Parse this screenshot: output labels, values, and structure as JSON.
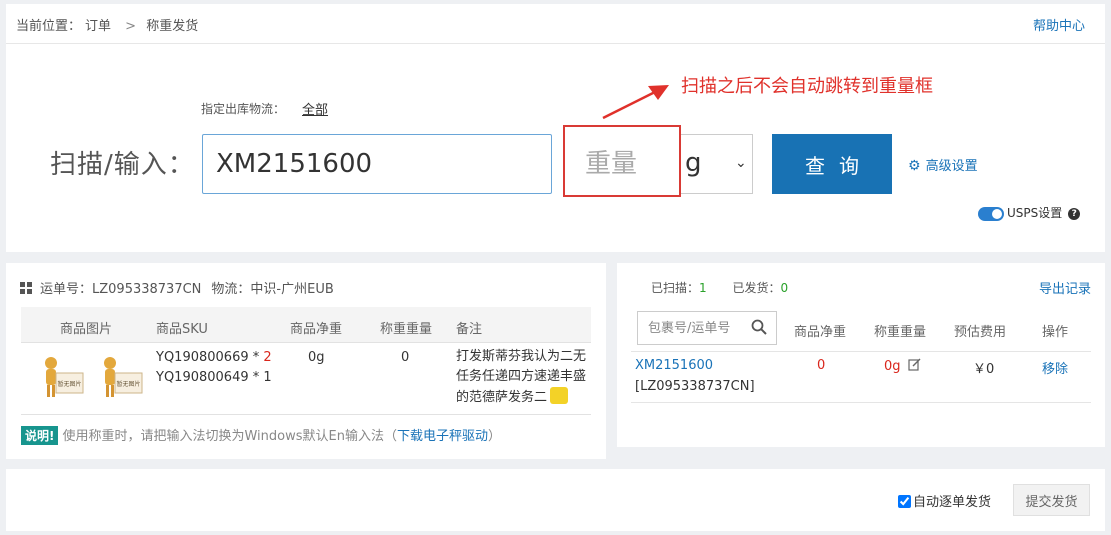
{
  "breadcrumb": {
    "prefix": "当前位置：",
    "items": [
      "订单",
      "称重发货"
    ],
    "separator": ">"
  },
  "help_link": "帮助中心",
  "dispatch": {
    "label": "指定出库物流：",
    "value": "全部"
  },
  "scan": {
    "label": "扫描/输入：",
    "value": "XM2151600",
    "weight_placeholder": "重量",
    "unit": "g",
    "query_button": "查询"
  },
  "advanced_settings": "高级设置",
  "usps": {
    "label": "USPS设置",
    "enabled": true
  },
  "annotation": {
    "text": "扫描之后不会自动跳转到重量框",
    "color": "#e0312b"
  },
  "order_panel": {
    "tracking_label": "运单号：",
    "tracking_no": "LZ095338737CN",
    "logistics_label": "物流：",
    "logistics": "中识-广州EUB",
    "columns": [
      "商品图片",
      "商品SKU",
      "商品净重",
      "称重重量",
      "备注"
    ],
    "row": {
      "images": [
        "暂无图片",
        "暂无图片"
      ],
      "skus": [
        {
          "sku": "YQ190800669",
          "qty": "2",
          "qty_highlight": true
        },
        {
          "sku": "YQ190800649",
          "qty": "1",
          "qty_highlight": false
        }
      ],
      "net_weight": "0g",
      "weighed": "0",
      "note": "打发斯蒂芬我认为二无任务任递四方速递丰盛的范德萨发务二"
    },
    "tip": {
      "badge": "说明!",
      "text": "使用称重时，请把输入法切换为Windows默认En输入法（",
      "link": "下载电子秤驱动",
      "suffix": "）"
    }
  },
  "scan_panel": {
    "scanned_label": "已扫描：",
    "scanned": "1",
    "shipped_label": "已发货：",
    "shipped": "0",
    "export_link": "导出记录",
    "search_placeholder": "包裹号/运单号",
    "columns": [
      "商品净重",
      "称重重量",
      "预估费用",
      "操作"
    ],
    "record": {
      "package_no": "XM2151600",
      "tracking_no": "[LZ095338737CN]",
      "net_weight": "0",
      "weighed": "0g",
      "fee": "￥0",
      "action": "移除"
    }
  },
  "footer": {
    "auto_label": "自动逐单发货",
    "auto_checked": true,
    "submit": "提交发货"
  },
  "colors": {
    "primary": "#1872b4",
    "danger": "#d9261c",
    "success": "#2aa12a",
    "teal": "#17958e"
  }
}
